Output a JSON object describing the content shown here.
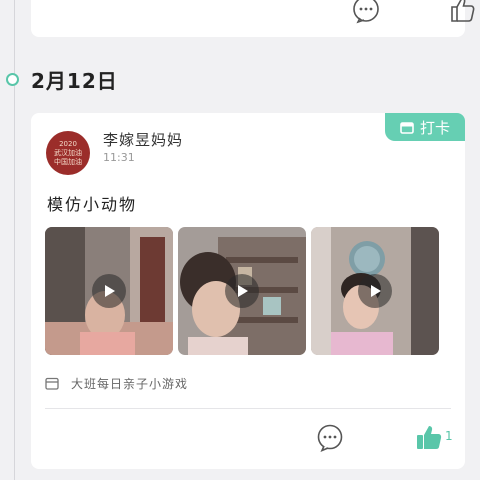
{
  "timeline": {
    "date": "2月12日"
  },
  "post": {
    "checkin_label": "打卡",
    "avatar_text": [
      "2020",
      "武汉加油",
      "中国加油"
    ],
    "user_name": "李嫁昱妈妈",
    "time": "11:31",
    "text": "模仿小动物",
    "videos": [
      {
        "label": "video-1"
      },
      {
        "label": "video-2"
      },
      {
        "label": "video-3"
      }
    ],
    "tag": "大班每日亲子小游戏",
    "like_count": "1"
  },
  "icons": {
    "calendar": "calendar-icon",
    "comment": "comment-icon",
    "like": "thumbs-up-icon",
    "play": "play-icon"
  },
  "colors": {
    "accent": "#66cfb3",
    "background": "#f1f1f3",
    "card": "#ffffff"
  }
}
